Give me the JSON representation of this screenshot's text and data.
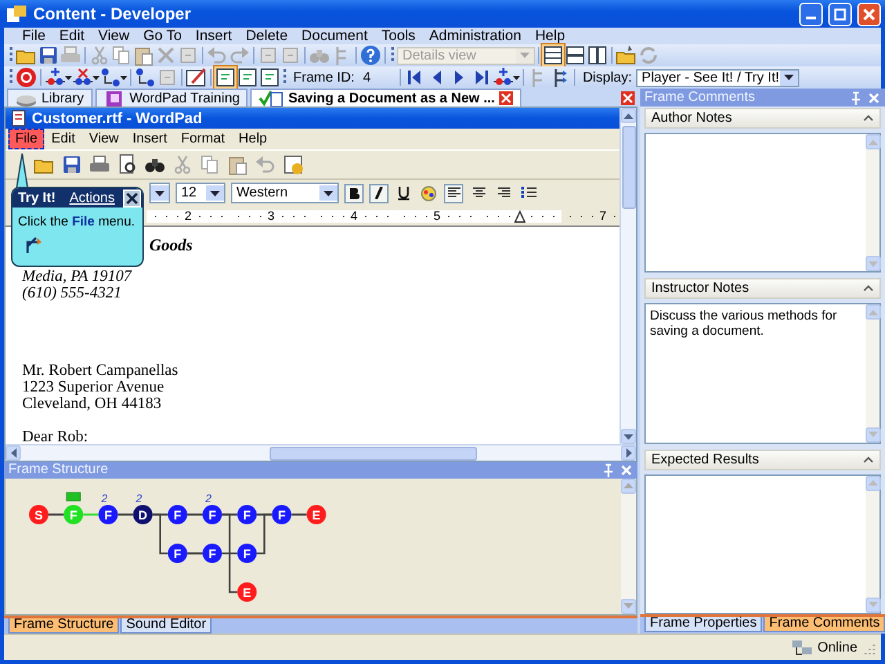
{
  "window": {
    "title": "Content - Developer"
  },
  "menu": [
    "File",
    "Edit",
    "View",
    "Go To",
    "Insert",
    "Delete",
    "Document",
    "Tools",
    "Administration",
    "Help"
  ],
  "toolbar": {
    "view_select": {
      "value": "Details view",
      "disabled": true
    },
    "frame_id_label": "Frame ID:",
    "frame_id": "4",
    "display_label": "Display:",
    "display_select": {
      "value": "Player - See It! / Try It!"
    }
  },
  "doc_tabs": [
    {
      "label": "Library",
      "selected": false,
      "kind": "library"
    },
    {
      "label": "WordPad Training",
      "selected": false,
      "kind": "module"
    },
    {
      "label": "Saving a Document as a New ...",
      "selected": true,
      "kind": "topic"
    }
  ],
  "wordpad": {
    "title": "Customer.rtf - WordPad",
    "menu": [
      {
        "label": "File",
        "selected": true
      },
      {
        "label": "Edit",
        "selected": false
      },
      {
        "label": "View",
        "selected": false
      },
      {
        "label": "Insert",
        "selected": false
      },
      {
        "label": "Format",
        "selected": false
      },
      {
        "label": "Help",
        "selected": false
      }
    ],
    "font_size": "12",
    "script": "Western",
    "ruler": [
      {
        "kind": "number",
        "label": "2"
      },
      {
        "kind": "number",
        "label": "3"
      },
      {
        "kind": "number",
        "label": "4"
      },
      {
        "kind": "number",
        "label": "5"
      },
      {
        "kind": "margin"
      },
      {
        "kind": "number",
        "label": "7"
      }
    ],
    "blocks": [
      {
        "kind": "letterhead",
        "lines": [
          "Goods",
          "Media, PA 19107",
          "(610) 555-4321"
        ]
      },
      {
        "kind": "address",
        "lines": [
          "Mr. Robert Campanellas",
          "1223 Superior Avenue",
          "Cleveland, OH 44183"
        ]
      },
      {
        "kind": "salutation",
        "lines": [
          "Dear Rob:"
        ]
      }
    ]
  },
  "callout": {
    "title": "Try It!",
    "link": "Actions",
    "text": "Click the **File** menu."
  },
  "frame_structure": {
    "title": "Frame Structure",
    "nodes": [
      {
        "label": "S",
        "color": "#ff1c1c"
      },
      {
        "label": "F",
        "color": "#22e022",
        "tag": true
      },
      {
        "label": "F",
        "color": "#1a1aff",
        "note": "2"
      },
      {
        "label": "D",
        "color": "#101070",
        "note": "2"
      },
      {
        "label": "F",
        "color": "#1a1aff"
      },
      {
        "label": "F",
        "color": "#1a1aff",
        "note": "2"
      },
      {
        "label": "F",
        "color": "#1a1aff"
      },
      {
        "label": "F",
        "color": "#1a1aff"
      },
      {
        "label": "E",
        "color": "#ff1c1c"
      },
      {
        "label": "F",
        "color": "#1a1aff"
      },
      {
        "label": "F",
        "color": "#1a1aff"
      },
      {
        "label": "F",
        "color": "#1a1aff"
      },
      {
        "label": "E",
        "color": "#ff1c1c"
      }
    ],
    "edges": [
      {
        "color": "#404040"
      },
      {
        "color": "#33dd33"
      },
      {
        "color": "#404040"
      },
      {
        "color": "#404040"
      },
      {
        "color": "#404040"
      },
      {
        "color": "#404040"
      },
      {
        "color": "#404040"
      },
      {
        "color": "#404040"
      },
      {
        "color": "#404040"
      },
      {
        "color": "#404040"
      },
      {
        "color": "#404040"
      },
      {
        "color": "#404040"
      },
      {
        "color": "#404040"
      }
    ],
    "tabs": [
      {
        "label": "Frame Structure",
        "selected": true
      },
      {
        "label": "Sound Editor",
        "selected": false
      }
    ]
  },
  "frame_comments": {
    "title": "Frame Comments",
    "sections": [
      {
        "title": "Author Notes"
      },
      {
        "title": "Instructor Notes",
        "text": "Discuss the various methods for saving a document."
      },
      {
        "title": "Expected Results"
      }
    ],
    "tabs": [
      {
        "label": "Frame Properties",
        "selected": false
      },
      {
        "label": "Frame Comments",
        "selected": true
      }
    ]
  },
  "status_bar": {
    "status": "Online"
  }
}
